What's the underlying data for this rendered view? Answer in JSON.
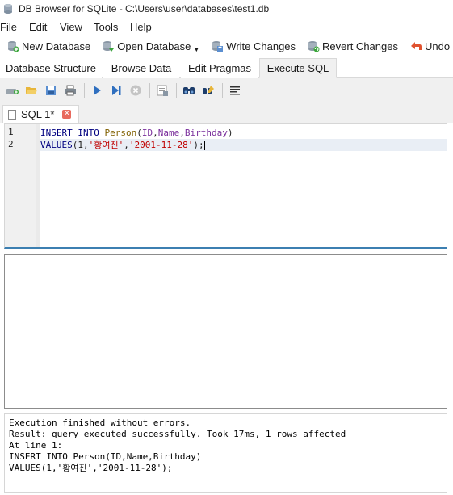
{
  "window": {
    "title": "DB Browser for SQLite - C:\\Users\\user\\databases\\test1.db"
  },
  "menu": [
    "File",
    "Edit",
    "View",
    "Tools",
    "Help"
  ],
  "toolbar": {
    "new_database": "New Database",
    "open_database": "Open Database",
    "write_changes": "Write Changes",
    "revert_changes": "Revert Changes",
    "undo": "Undo"
  },
  "tabs": [
    "Database Structure",
    "Browse Data",
    "Edit Pragmas",
    "Execute SQL"
  ],
  "active_tab": "Execute SQL",
  "sql_toolbar_icons": [
    "open-tab-icon",
    "open-sql-file-icon",
    "save-sql-file-icon",
    "print-icon",
    "execute-all-icon",
    "execute-line-icon",
    "stop-execution-icon",
    "save-results-icon",
    "find-icon",
    "find-replace-icon",
    "comment-icon"
  ],
  "editor": {
    "tab_label": "SQL 1*",
    "line_numbers": [
      "1",
      "2"
    ],
    "lines": [
      {
        "tokens": [
          {
            "t": "INSERT",
            "c": "kw"
          },
          {
            "t": " ",
            "c": "punc"
          },
          {
            "t": "INTO",
            "c": "kw"
          },
          {
            "t": " ",
            "c": "punc"
          },
          {
            "t": "Person",
            "c": "tbl"
          },
          {
            "t": "(",
            "c": "punc"
          },
          {
            "t": "ID",
            "c": "col"
          },
          {
            "t": ",",
            "c": "punc"
          },
          {
            "t": "Name",
            "c": "col"
          },
          {
            "t": ",",
            "c": "punc"
          },
          {
            "t": "Birthday",
            "c": "col"
          },
          {
            "t": ")",
            "c": "punc"
          }
        ]
      },
      {
        "tokens": [
          {
            "t": "VALUES",
            "c": "kw"
          },
          {
            "t": "(",
            "c": "punc"
          },
          {
            "t": "1",
            "c": "num"
          },
          {
            "t": ",",
            "c": "punc"
          },
          {
            "t": "'황여진'",
            "c": "str"
          },
          {
            "t": ",",
            "c": "punc"
          },
          {
            "t": "'2001-11-28'",
            "c": "str"
          },
          {
            "t": ");",
            "c": "punc"
          }
        ]
      }
    ]
  },
  "messages": [
    "Execution finished without errors.",
    "Result: query executed successfully. Took 17ms, 1 rows affected",
    "At line 1:",
    "INSERT INTO Person(ID,Name,Birthday)",
    "VALUES(1,'황여진','2001-11-28');"
  ],
  "colors": {
    "keyword": "#000080",
    "table": "#806000",
    "column": "#7a2f9c",
    "string": "#c00000",
    "current_line": "#e9eef5",
    "editor_focus_border": "#3c7fb1"
  }
}
